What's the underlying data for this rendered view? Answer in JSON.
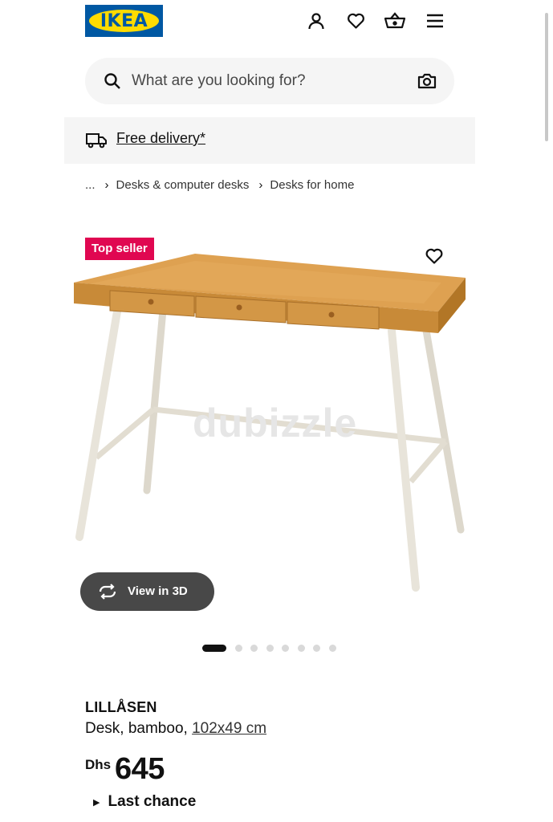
{
  "header": {
    "logo_text": "IKEA",
    "icons": [
      "user-icon",
      "heart-icon",
      "basket-icon",
      "menu-icon"
    ]
  },
  "search": {
    "placeholder": "What are you looking for?",
    "icons": [
      "search-icon",
      "camera-icon"
    ]
  },
  "delivery": {
    "label": "Free delivery*",
    "icon": "truck-icon"
  },
  "breadcrumb": {
    "items": [
      "...",
      "Desks & computer desks",
      "Desks for home"
    ]
  },
  "product_image": {
    "badge": "Top seller",
    "watermark": "dubizzle",
    "view3d_label": "View in 3D",
    "carousel_count": 8,
    "carousel_active": 1
  },
  "product": {
    "name": "LILLÅSEN",
    "description": "Desk, bamboo, ",
    "size": "102x49 cm",
    "currency": "Dhs",
    "price": "645",
    "status": "Last chance"
  },
  "colors": {
    "ikea_blue": "#0058a3",
    "ikea_yellow": "#ffdb00",
    "badge_red": "#e00751",
    "button_dark": "#484848"
  }
}
